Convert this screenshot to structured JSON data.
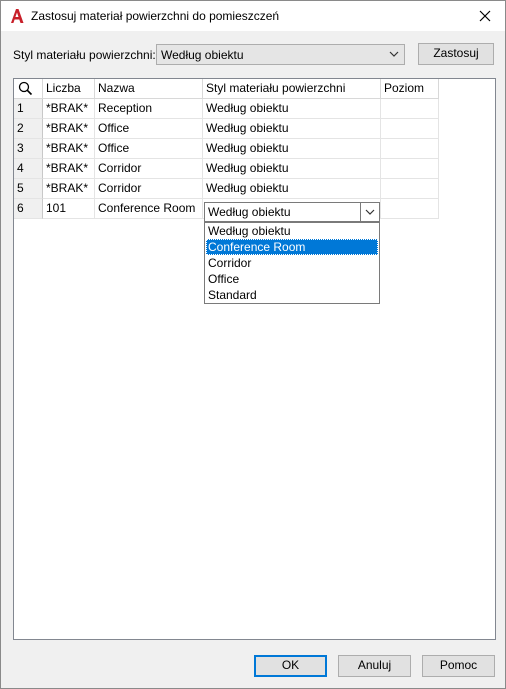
{
  "window": {
    "title": "Zastosuj materiał powierzchni do pomieszczeń"
  },
  "icons": {
    "app": "autocad-a-icon",
    "close": "close-icon",
    "search": "search-icon",
    "chevron": "chevron-down-icon"
  },
  "colors": {
    "accent": "#0078d7",
    "app_icon": "#c8202a"
  },
  "style_field": {
    "label": "Styl materiału powierzchni:",
    "value": "Według obiektu"
  },
  "apply_button": "Zastosuj",
  "table": {
    "columns": [
      "Liczba",
      "Nazwa",
      "Styl materiału powierzchni",
      "Poziom"
    ],
    "rows": [
      {
        "num": "1",
        "liczba": "*BRAK*",
        "nazwa": "Reception",
        "styl": "Według obiektu",
        "poziom": ""
      },
      {
        "num": "2",
        "liczba": "*BRAK*",
        "nazwa": "Office",
        "styl": "Według obiektu",
        "poziom": ""
      },
      {
        "num": "3",
        "liczba": "*BRAK*",
        "nazwa": "Office",
        "styl": "Według obiektu",
        "poziom": ""
      },
      {
        "num": "4",
        "liczba": "*BRAK*",
        "nazwa": "Corridor",
        "styl": "Według obiektu",
        "poziom": ""
      },
      {
        "num": "5",
        "liczba": "*BRAK*",
        "nazwa": "Corridor",
        "styl": "Według obiektu",
        "poziom": ""
      },
      {
        "num": "6",
        "liczba": "101",
        "nazwa": "Conference Room",
        "styl": "Według obiektu",
        "poziom": ""
      }
    ]
  },
  "dropdown": {
    "options": [
      "Według obiektu",
      "Conference Room",
      "Corridor",
      "Office",
      "Standard"
    ],
    "selected": "Conference Room"
  },
  "buttons": {
    "ok": "OK",
    "cancel": "Anuluj",
    "help": "Pomoc"
  }
}
